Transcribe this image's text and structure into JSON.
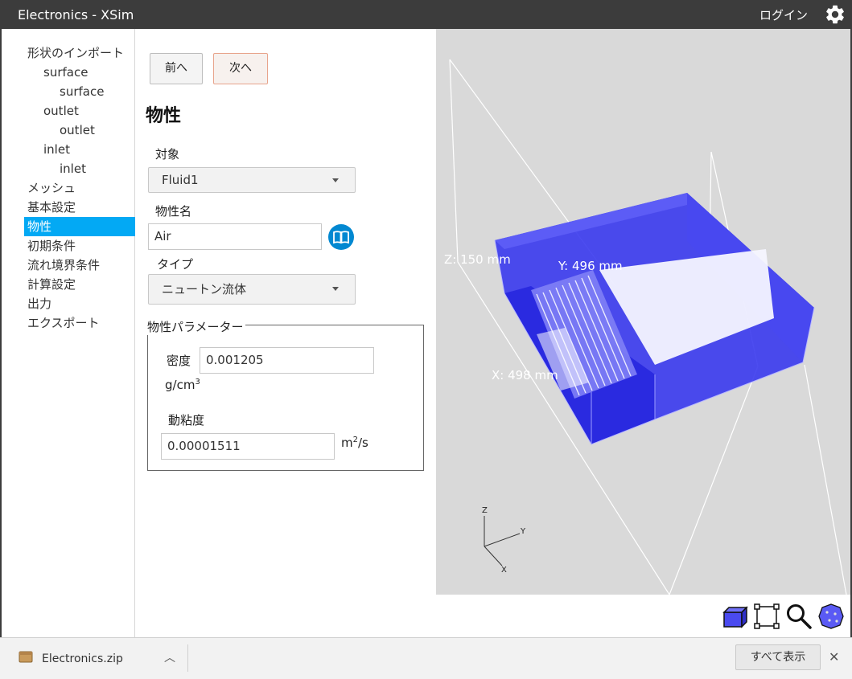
{
  "window": {
    "title": "Electronics - XSim",
    "login_label": "ログイン",
    "settings_icon": "gear-icon"
  },
  "sidebar": {
    "items": [
      {
        "label": "形状のインポート",
        "level": 0
      },
      {
        "label": "surface",
        "level": 1
      },
      {
        "label": "surface",
        "level": 2
      },
      {
        "label": "outlet",
        "level": 1
      },
      {
        "label": "outlet",
        "level": 2
      },
      {
        "label": "inlet",
        "level": 1
      },
      {
        "label": "inlet",
        "level": 2
      },
      {
        "label": "メッシュ",
        "level": 0
      },
      {
        "label": "基本設定",
        "level": 0
      },
      {
        "label": "物性",
        "level": 0,
        "active": true
      },
      {
        "label": "初期条件",
        "level": 0
      },
      {
        "label": "流れ境界条件",
        "level": 0
      },
      {
        "label": "計算設定",
        "level": 0
      },
      {
        "label": "出力",
        "level": 0
      },
      {
        "label": "エクスポート",
        "level": 0
      }
    ]
  },
  "nav_buttons": {
    "prev": "前へ",
    "next": "次へ"
  },
  "form": {
    "heading": "物性",
    "target_label": "対象",
    "target_value": "Fluid1",
    "material_name_label": "物性名",
    "material_name_value": "Air",
    "library_icon": "book-icon",
    "type_label": "タイプ",
    "type_value": "ニュートン流体",
    "params_legend": "物性パラメーター",
    "density_label": "密度",
    "density_value": "0.001205",
    "density_unit_base": "g/cm",
    "density_unit_exp": "3",
    "viscosity_label": "動粘度",
    "viscosity_value": "0.00001511",
    "viscosity_unit_base": "m",
    "viscosity_unit_exp": "2",
    "viscosity_unit_tail": "/s"
  },
  "viewport": {
    "dim_z": "Z: 150 mm",
    "dim_y": "Y: 496 mm",
    "dim_x": "X: 498 mm",
    "axis_z": "Z",
    "axis_y": "Y",
    "axis_x": "X",
    "box_color": "#4a4af0"
  },
  "toolbar": [
    "cube-icon",
    "fit-view-icon",
    "zoom-icon",
    "sphere-icon"
  ],
  "download_bar": {
    "file_name": "Electronics.zip",
    "show_all": "すべて表示",
    "close": "✕",
    "chevron": "︿"
  }
}
